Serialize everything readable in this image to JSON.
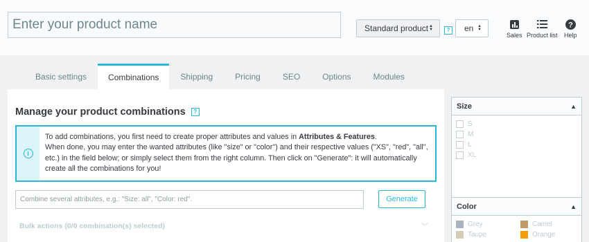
{
  "header": {
    "product_name_placeholder": "Enter your product name",
    "product_type": "Standard product",
    "help_label": "?",
    "language": "en",
    "tools": [
      {
        "label": "Sales",
        "icon": "bar-chart-icon"
      },
      {
        "label": "Product list",
        "icon": "list-icon"
      },
      {
        "label": "Help",
        "icon": "help-icon"
      }
    ]
  },
  "tabs": [
    "Basic settings",
    "Combinations",
    "Shipping",
    "Pricing",
    "SEO",
    "Options",
    "Modules"
  ],
  "active_tab": "Combinations",
  "main": {
    "title": "Manage your product combinations",
    "alert": {
      "line1_pre": "To add combinations, you first need to create proper attributes and values in ",
      "line1_bold": "Attributes & Features",
      "line1_post": ".",
      "rest": "When done, you may enter the wanted attributes (like \"size\" or \"color\") and their respective values (\"XS\", \"red\", \"all\", etc.) in the field below; or simply select them from the right column. Then click on \"Generate\": it will automatically create all the combinations for you!"
    },
    "combine_placeholder": "Combine several attributes, e.g.: \"Size: all\", \"Color: red\".",
    "generate_label": "Generate",
    "bulk_actions": "Bulk actions (0/0 combination(s) selected)"
  },
  "sidebar": {
    "size": {
      "title": "Size",
      "options": [
        "S",
        "M",
        "L",
        "XL"
      ]
    },
    "color": {
      "title": "Color",
      "options": [
        {
          "name": "Grey",
          "color": "#aab2bd"
        },
        {
          "name": "Camel",
          "color": "#c19a6b"
        },
        {
          "name": "Taupe",
          "color": "#d5ccb5"
        },
        {
          "name": "Orange",
          "color": "#f39d0d"
        }
      ]
    }
  },
  "colors": {
    "accent": "#25b9d7",
    "text": "#363a41",
    "muted": "#6c868e",
    "border": "#bbcdd2",
    "band": "#eff1f2"
  }
}
